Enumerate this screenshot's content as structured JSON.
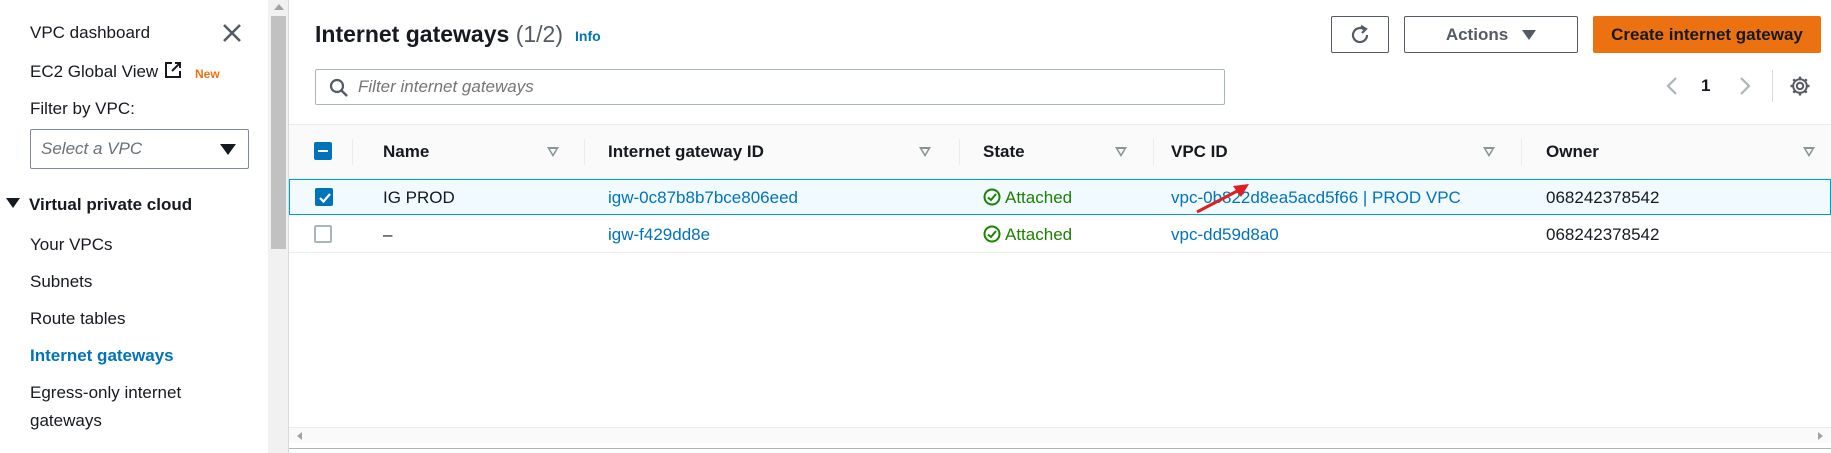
{
  "sidebar": {
    "dashboard": "VPC dashboard",
    "global_view": "EC2 Global View",
    "new_badge": "New",
    "filter_label": "Filter by VPC:",
    "filter_placeholder": "Select a VPC",
    "section_title": "Virtual private cloud",
    "items": [
      {
        "label": "Your VPCs"
      },
      {
        "label": "Subnets"
      },
      {
        "label": "Route tables"
      },
      {
        "label": "Internet gateways",
        "active": true
      },
      {
        "label": "Egress-only internet"
      },
      {
        "label": "gateways"
      }
    ]
  },
  "header": {
    "title": "Internet gateways",
    "count": "(1/2)",
    "info": "Info",
    "actions_label": "Actions",
    "create_label": "Create internet gateway",
    "filter_placeholder": "Filter internet gateways",
    "page": "1"
  },
  "table": {
    "columns": [
      "Name",
      "Internet gateway ID",
      "State",
      "VPC ID",
      "Owner"
    ],
    "rows": [
      {
        "selected": true,
        "name": "IG PROD",
        "id": "igw-0c87b8b7bce806eed",
        "state": "Attached",
        "vpc": "vpc-0b822d8ea5acd5f66 | PROD VPC",
        "owner": "068242378542"
      },
      {
        "selected": false,
        "name": "–",
        "id": "igw-f429dd8e",
        "state": "Attached",
        "vpc": "vpc-dd59d8a0",
        "owner": "068242378542"
      }
    ]
  },
  "colors": {
    "accent": "#0073bb",
    "primary_button": "#ec7211",
    "success": "#1d8102",
    "annotation_arrow": "#e02020"
  },
  "icons": [
    "close-icon",
    "external-link-icon",
    "caret-down-icon",
    "refresh-icon",
    "search-icon",
    "chevron-left-icon",
    "chevron-right-icon",
    "gear-icon",
    "sort-icon",
    "check-circle-icon",
    "checkbox-icon"
  ]
}
